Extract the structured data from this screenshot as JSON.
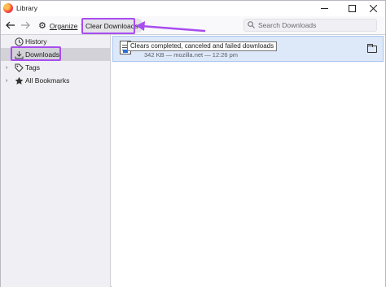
{
  "window": {
    "title": "Library",
    "controls": {
      "minimize": "—",
      "maximize": "☐",
      "close": "✕"
    }
  },
  "toolbar": {
    "back_icon": "arrow-left-icon",
    "forward_icon": "arrow-right-icon",
    "organize_label": "Organize",
    "clear_downloads_label": "Clear Downloads",
    "search_placeholder": "Search Downloads"
  },
  "sidebar": {
    "items": [
      {
        "label": "History",
        "icon": "clock-icon",
        "expandable": false,
        "selected": false
      },
      {
        "label": "Downloads",
        "icon": "download-icon",
        "expandable": false,
        "selected": true
      },
      {
        "label": "Tags",
        "icon": "tag-icon",
        "expandable": true,
        "selected": false
      },
      {
        "label": "All Bookmarks",
        "icon": "star-icon",
        "expandable": true,
        "selected": false
      }
    ]
  },
  "downloads": [
    {
      "tooltip": "Clears completed, canceled and failed downloads",
      "size": "342 KB",
      "source": "mozilla.net",
      "time": "12:26 pm",
      "meta": "342 KB — mozilla.net — 12:26 pm"
    }
  ],
  "colors": {
    "annotation": "#a84df0",
    "selected_row": "#dde8f8",
    "sidebar_selected": "#d2d2d8"
  }
}
